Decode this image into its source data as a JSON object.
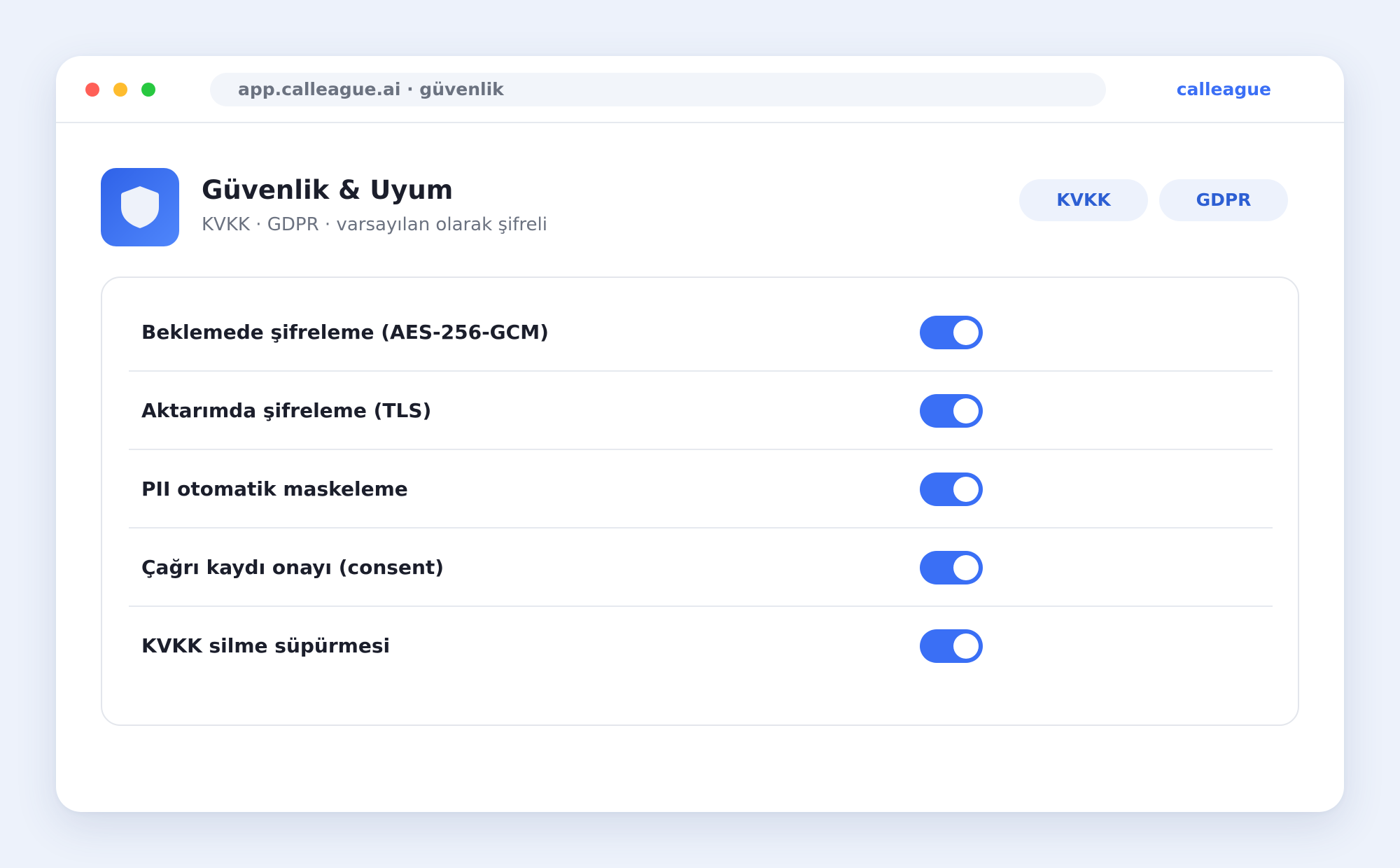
{
  "browser": {
    "address": "app.calleague.ai · güvenlik",
    "brand": "calleague"
  },
  "header": {
    "icon": "shield-icon",
    "title": "Güvenlik & Uyum",
    "subtitle": "KVKK · GDPR · varsayılan olarak şifreli",
    "badges": [
      "KVKK",
      "GDPR"
    ]
  },
  "settings": [
    {
      "label": "Beklemede şifreleme (AES-256-GCM)",
      "enabled": true
    },
    {
      "label": "Aktarımda şifreleme (TLS)",
      "enabled": true
    },
    {
      "label": "PII otomatik maskeleme",
      "enabled": true
    },
    {
      "label": "Çağrı kaydı onayı (consent)",
      "enabled": true
    },
    {
      "label": "KVKK silme süpürmesi",
      "enabled": true
    }
  ],
  "colors": {
    "accent": "#3a6ff5",
    "background": "#edf2fb"
  }
}
